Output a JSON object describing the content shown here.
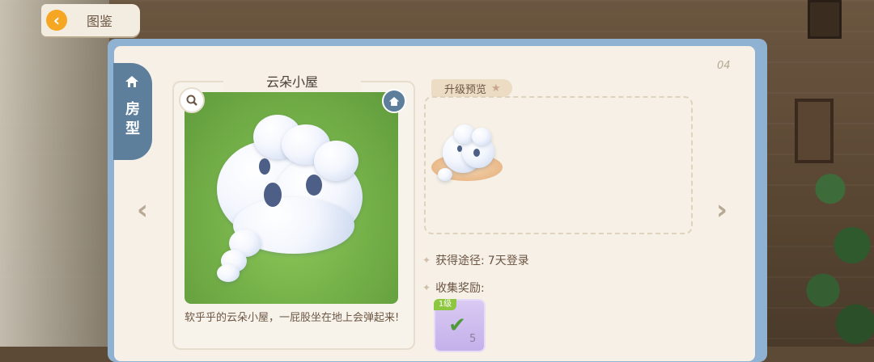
{
  "header": {
    "back_label": "图鉴",
    "back_icon": "chevron-left-icon"
  },
  "sidebar": {
    "tab_label": "房\n型",
    "tab_icon": "house-icon"
  },
  "page": {
    "number": "04"
  },
  "card": {
    "title": "云朵小屋",
    "description": "软乎乎的云朵小屋，一屁股坐在地上会弹起来!",
    "zoom_icon": "magnifier-icon",
    "badge_icon": "house-icon"
  },
  "upgrade": {
    "label": "升级预览"
  },
  "source": {
    "label": "获得途径:",
    "value": "7天登录"
  },
  "reward": {
    "label": "收集奖励:",
    "level": "1级",
    "count": "5"
  },
  "colors": {
    "accent": "#5d7f9c",
    "panel": "#f6f0e6",
    "frame": "#8fb2d2",
    "text": "#6b5644"
  }
}
